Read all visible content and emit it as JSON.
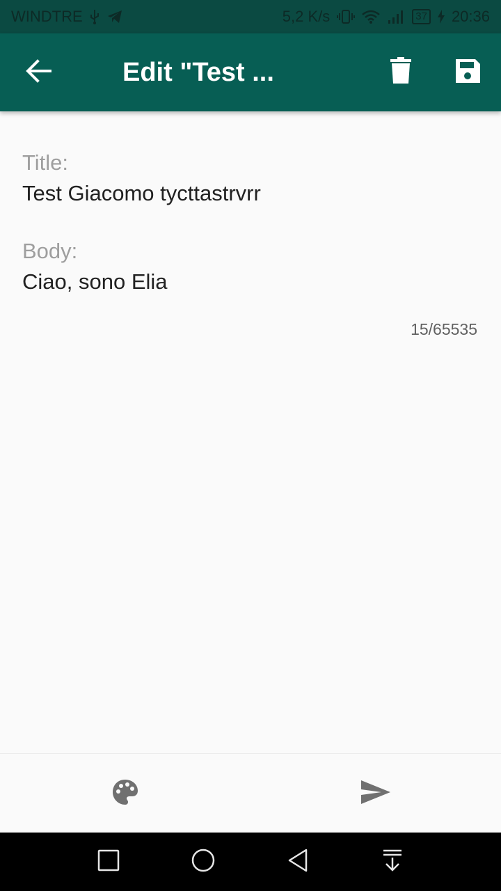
{
  "status_bar": {
    "carrier": "WINDTRE",
    "network_speed": "5,2 K/s",
    "battery_level": "37",
    "time": "20:36",
    "icons": [
      "usb-icon",
      "telegram-icon",
      "vibrate-icon",
      "wifi-icon",
      "signal-icon",
      "battery-icon",
      "charging-icon"
    ]
  },
  "app_bar": {
    "title": "Edit \"Test ...",
    "background": "#075e54",
    "icons": [
      "back-arrow-icon",
      "trash-icon",
      "save-icon"
    ]
  },
  "note": {
    "title_label": "Title:",
    "title_value": "Test Giacomo tycttastrvrr",
    "body_label": "Body:",
    "body_value": "Ciao, sono Elia",
    "char_counter": "15/65535"
  },
  "bottom_bar": {
    "icons": [
      "palette-icon",
      "send-icon"
    ]
  },
  "nav_bar": {
    "icons": [
      "recents-square-icon",
      "home-circle-icon",
      "back-triangle-icon",
      "notification-pull-icon"
    ]
  }
}
